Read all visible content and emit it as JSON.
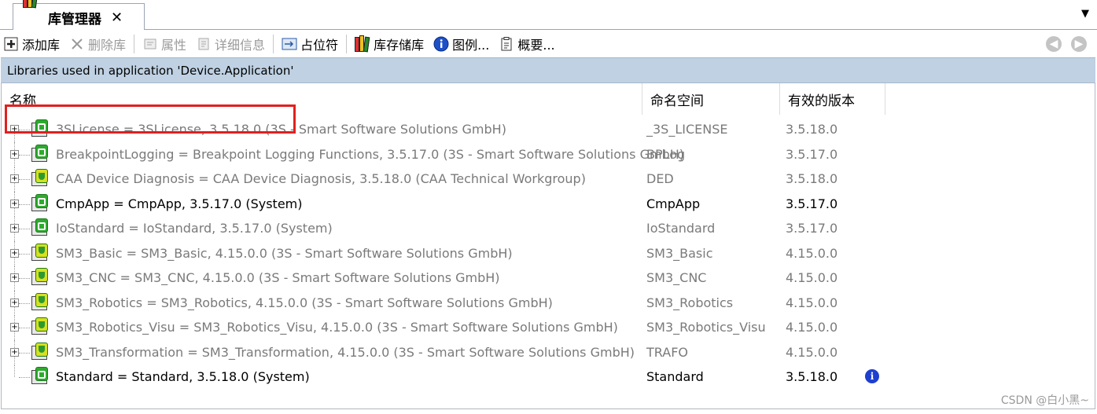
{
  "tab": {
    "title": "库管理器",
    "close": "✕",
    "menu_arrow": "▼"
  },
  "toolbar": {
    "add_library": "添加库",
    "delete_library": "删除库",
    "properties": "属性",
    "details": "详细信息",
    "placeholder": "占位符",
    "repository": "库存储库",
    "legend": "图例...",
    "overview": "概要..."
  },
  "nav": {
    "back": "◀",
    "forward": "▶"
  },
  "info_bar": {
    "text": "Libraries used in application 'Device.Application'"
  },
  "table": {
    "columns": {
      "name": "名称",
      "namespace": "命名空间",
      "version": "有效的版本"
    },
    "rows": [
      {
        "name": "3SLicense = 3SLicense, 3.5.18.0 (3S - Smart Software Solutions GmbH)",
        "namespace": "_3S_LICENSE",
        "version": "3.5.18.0",
        "style": "gray",
        "icon": "lock",
        "expandable": true
      },
      {
        "name": "BreakpointLogging = Breakpoint Logging Functions, 3.5.17.0 (3S - Smart Software Solutions GmbH)",
        "namespace": "BPLog",
        "version": "3.5.17.0",
        "style": "gray",
        "icon": "lock",
        "expandable": true
      },
      {
        "name": "CAA Device Diagnosis = CAA Device Diagnosis, 3.5.18.0 (CAA Technical Workgroup)",
        "namespace": "DED",
        "version": "3.5.18.0",
        "style": "gray",
        "icon": "shield",
        "expandable": true
      },
      {
        "name": "CmpApp = CmpApp, 3.5.17.0 (System)",
        "namespace": "CmpApp",
        "version": "3.5.17.0",
        "style": "black",
        "icon": "lock",
        "expandable": true
      },
      {
        "name": "IoStandard = IoStandard, 3.5.17.0 (System)",
        "namespace": "IoStandard",
        "version": "3.5.17.0",
        "style": "gray",
        "icon": "lock",
        "expandable": true
      },
      {
        "name": "SM3_Basic = SM3_Basic, 4.15.0.0 (3S - Smart Software Solutions GmbH)",
        "namespace": "SM3_Basic",
        "version": "4.15.0.0",
        "style": "gray",
        "icon": "shield",
        "expandable": true
      },
      {
        "name": "SM3_CNC = SM3_CNC, 4.15.0.0 (3S - Smart Software Solutions GmbH)",
        "namespace": "SM3_CNC",
        "version": "4.15.0.0",
        "style": "gray",
        "icon": "shield",
        "expandable": true
      },
      {
        "name": "SM3_Robotics = SM3_Robotics, 4.15.0.0 (3S - Smart Software Solutions GmbH)",
        "namespace": "SM3_Robotics",
        "version": "4.15.0.0",
        "style": "gray",
        "icon": "shield",
        "expandable": true
      },
      {
        "name": "SM3_Robotics_Visu = SM3_Robotics_Visu, 4.15.0.0 (3S - Smart Software Solutions GmbH)",
        "namespace": "SM3_Robotics_Visu",
        "version": "4.15.0.0",
        "style": "gray",
        "icon": "shield",
        "expandable": true
      },
      {
        "name": "SM3_Transformation = SM3_Transformation, 4.15.0.0 (3S - Smart Software Solutions GmbH)",
        "namespace": "TRAFO",
        "version": "4.15.0.0",
        "style": "gray",
        "icon": "shield",
        "expandable": true
      },
      {
        "name": "Standard = Standard, 3.5.18.0 (System)",
        "namespace": "Standard",
        "version": "3.5.18.0",
        "style": "black",
        "icon": "lock",
        "expandable": false,
        "info": "i"
      }
    ]
  },
  "watermark": "CSDN @白小黑~",
  "colors": {
    "info_bar_bg": "#bfd1e3",
    "highlight": "#e02020",
    "gray_text": "#7a7a7a"
  }
}
